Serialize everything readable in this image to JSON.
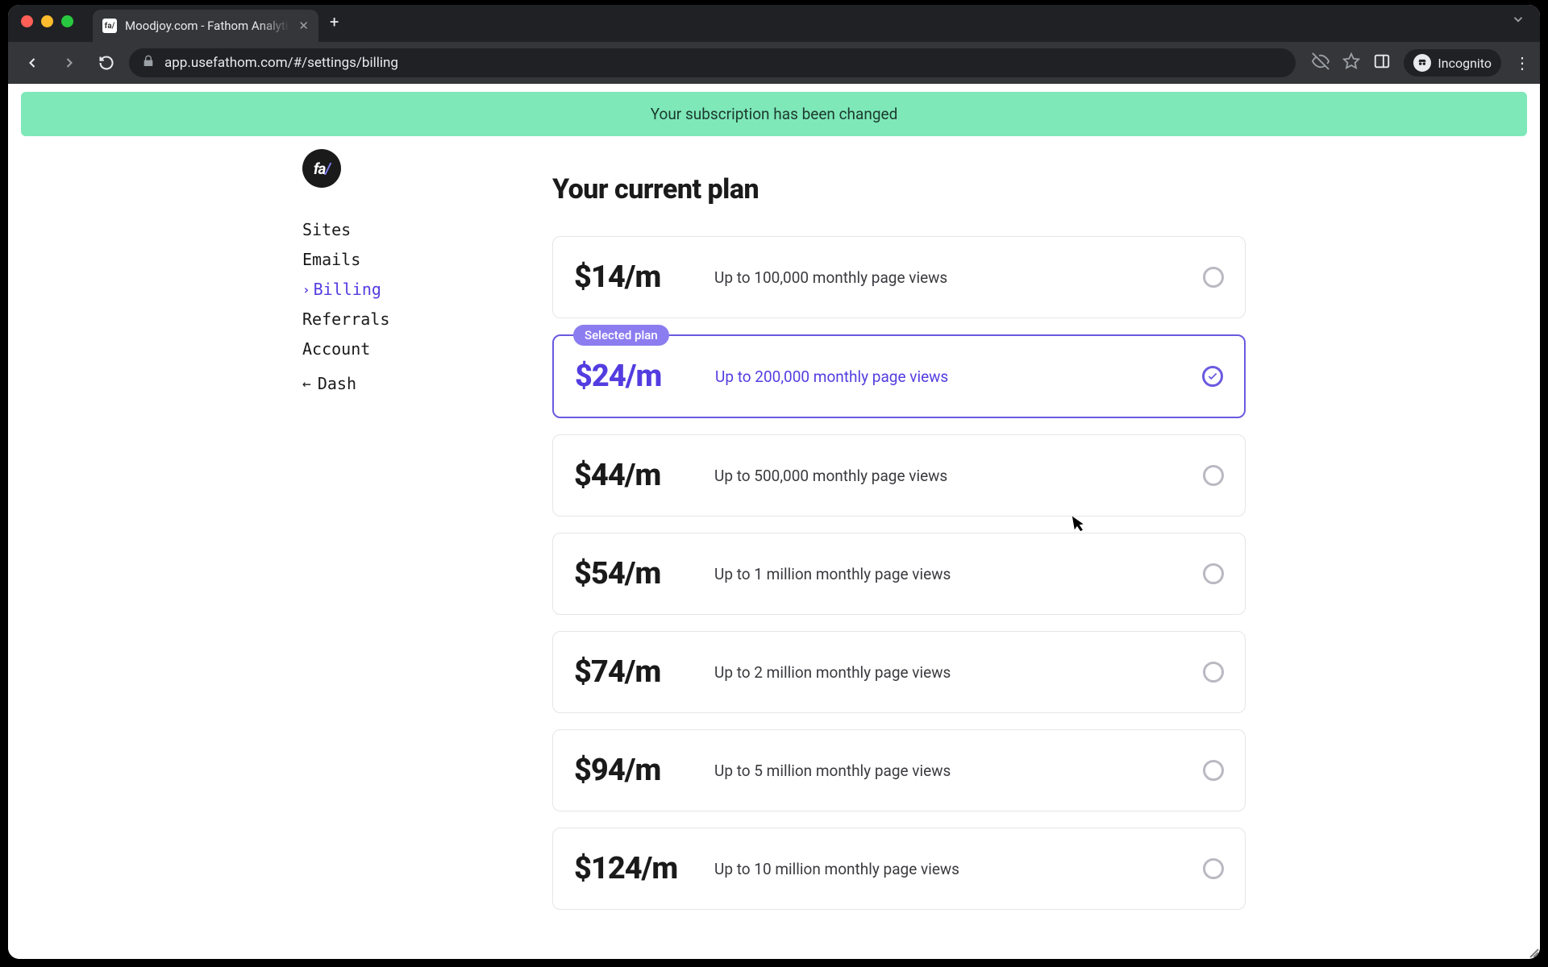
{
  "browser": {
    "tab_title": "Moodjoy.com - Fathom Analyti",
    "favicon_text": "fa/",
    "url": "app.usefathom.com/#/settings/billing",
    "profile_label": "Incognito"
  },
  "banner": {
    "message": "Your subscription has been changed"
  },
  "sidebar": {
    "logo_text": "fa",
    "logo_slash": "/",
    "items": [
      {
        "label": "Sites",
        "active": false
      },
      {
        "label": "Emails",
        "active": false
      },
      {
        "label": "Billing",
        "active": true
      },
      {
        "label": "Referrals",
        "active": false
      },
      {
        "label": "Account",
        "active": false
      }
    ],
    "back": {
      "label": "Dash"
    }
  },
  "main": {
    "heading": "Your current plan",
    "selected_badge": "Selected plan",
    "plans": [
      {
        "price": "$14",
        "per": "/m",
        "desc": "Up to 100,000 monthly page views",
        "selected": false
      },
      {
        "price": "$24",
        "per": "/m",
        "desc": "Up to 200,000 monthly page views",
        "selected": true
      },
      {
        "price": "$44",
        "per": "/m",
        "desc": "Up to 500,000 monthly page views",
        "selected": false
      },
      {
        "price": "$54",
        "per": "/m",
        "desc": "Up to 1 million monthly page views",
        "selected": false
      },
      {
        "price": "$74",
        "per": "/m",
        "desc": "Up to 2 million monthly page views",
        "selected": false
      },
      {
        "price": "$94",
        "per": "/m",
        "desc": "Up to 5 million monthly page views",
        "selected": false
      },
      {
        "price": "$124",
        "per": "/m",
        "desc": "Up to 10 million monthly page views",
        "selected": false
      }
    ]
  },
  "colors": {
    "accent": "#533de0",
    "banner_bg": "#7ee8b8"
  }
}
